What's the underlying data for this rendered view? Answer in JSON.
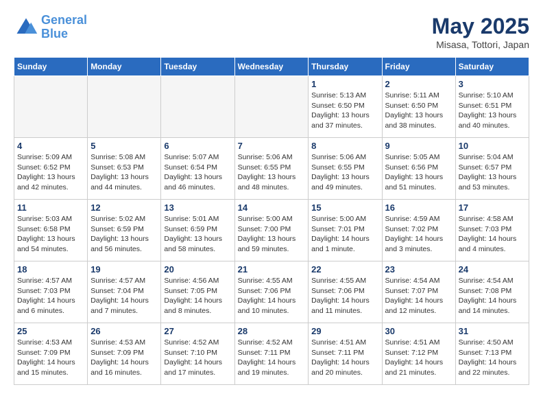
{
  "logo": {
    "line1": "General",
    "line2": "Blue"
  },
  "title": "May 2025",
  "subtitle": "Misasa, Tottori, Japan",
  "weekdays": [
    "Sunday",
    "Monday",
    "Tuesday",
    "Wednesday",
    "Thursday",
    "Friday",
    "Saturday"
  ],
  "weeks": [
    [
      {
        "day": "",
        "info": ""
      },
      {
        "day": "",
        "info": ""
      },
      {
        "day": "",
        "info": ""
      },
      {
        "day": "",
        "info": ""
      },
      {
        "day": "1",
        "info": "Sunrise: 5:13 AM\nSunset: 6:50 PM\nDaylight: 13 hours\nand 37 minutes."
      },
      {
        "day": "2",
        "info": "Sunrise: 5:11 AM\nSunset: 6:50 PM\nDaylight: 13 hours\nand 38 minutes."
      },
      {
        "day": "3",
        "info": "Sunrise: 5:10 AM\nSunset: 6:51 PM\nDaylight: 13 hours\nand 40 minutes."
      }
    ],
    [
      {
        "day": "4",
        "info": "Sunrise: 5:09 AM\nSunset: 6:52 PM\nDaylight: 13 hours\nand 42 minutes."
      },
      {
        "day": "5",
        "info": "Sunrise: 5:08 AM\nSunset: 6:53 PM\nDaylight: 13 hours\nand 44 minutes."
      },
      {
        "day": "6",
        "info": "Sunrise: 5:07 AM\nSunset: 6:54 PM\nDaylight: 13 hours\nand 46 minutes."
      },
      {
        "day": "7",
        "info": "Sunrise: 5:06 AM\nSunset: 6:55 PM\nDaylight: 13 hours\nand 48 minutes."
      },
      {
        "day": "8",
        "info": "Sunrise: 5:06 AM\nSunset: 6:55 PM\nDaylight: 13 hours\nand 49 minutes."
      },
      {
        "day": "9",
        "info": "Sunrise: 5:05 AM\nSunset: 6:56 PM\nDaylight: 13 hours\nand 51 minutes."
      },
      {
        "day": "10",
        "info": "Sunrise: 5:04 AM\nSunset: 6:57 PM\nDaylight: 13 hours\nand 53 minutes."
      }
    ],
    [
      {
        "day": "11",
        "info": "Sunrise: 5:03 AM\nSunset: 6:58 PM\nDaylight: 13 hours\nand 54 minutes."
      },
      {
        "day": "12",
        "info": "Sunrise: 5:02 AM\nSunset: 6:59 PM\nDaylight: 13 hours\nand 56 minutes."
      },
      {
        "day": "13",
        "info": "Sunrise: 5:01 AM\nSunset: 6:59 PM\nDaylight: 13 hours\nand 58 minutes."
      },
      {
        "day": "14",
        "info": "Sunrise: 5:00 AM\nSunset: 7:00 PM\nDaylight: 13 hours\nand 59 minutes."
      },
      {
        "day": "15",
        "info": "Sunrise: 5:00 AM\nSunset: 7:01 PM\nDaylight: 14 hours\nand 1 minute."
      },
      {
        "day": "16",
        "info": "Sunrise: 4:59 AM\nSunset: 7:02 PM\nDaylight: 14 hours\nand 3 minutes."
      },
      {
        "day": "17",
        "info": "Sunrise: 4:58 AM\nSunset: 7:03 PM\nDaylight: 14 hours\nand 4 minutes."
      }
    ],
    [
      {
        "day": "18",
        "info": "Sunrise: 4:57 AM\nSunset: 7:03 PM\nDaylight: 14 hours\nand 6 minutes."
      },
      {
        "day": "19",
        "info": "Sunrise: 4:57 AM\nSunset: 7:04 PM\nDaylight: 14 hours\nand 7 minutes."
      },
      {
        "day": "20",
        "info": "Sunrise: 4:56 AM\nSunset: 7:05 PM\nDaylight: 14 hours\nand 8 minutes."
      },
      {
        "day": "21",
        "info": "Sunrise: 4:55 AM\nSunset: 7:06 PM\nDaylight: 14 hours\nand 10 minutes."
      },
      {
        "day": "22",
        "info": "Sunrise: 4:55 AM\nSunset: 7:06 PM\nDaylight: 14 hours\nand 11 minutes."
      },
      {
        "day": "23",
        "info": "Sunrise: 4:54 AM\nSunset: 7:07 PM\nDaylight: 14 hours\nand 12 minutes."
      },
      {
        "day": "24",
        "info": "Sunrise: 4:54 AM\nSunset: 7:08 PM\nDaylight: 14 hours\nand 14 minutes."
      }
    ],
    [
      {
        "day": "25",
        "info": "Sunrise: 4:53 AM\nSunset: 7:09 PM\nDaylight: 14 hours\nand 15 minutes."
      },
      {
        "day": "26",
        "info": "Sunrise: 4:53 AM\nSunset: 7:09 PM\nDaylight: 14 hours\nand 16 minutes."
      },
      {
        "day": "27",
        "info": "Sunrise: 4:52 AM\nSunset: 7:10 PM\nDaylight: 14 hours\nand 17 minutes."
      },
      {
        "day": "28",
        "info": "Sunrise: 4:52 AM\nSunset: 7:11 PM\nDaylight: 14 hours\nand 19 minutes."
      },
      {
        "day": "29",
        "info": "Sunrise: 4:51 AM\nSunset: 7:11 PM\nDaylight: 14 hours\nand 20 minutes."
      },
      {
        "day": "30",
        "info": "Sunrise: 4:51 AM\nSunset: 7:12 PM\nDaylight: 14 hours\nand 21 minutes."
      },
      {
        "day": "31",
        "info": "Sunrise: 4:50 AM\nSunset: 7:13 PM\nDaylight: 14 hours\nand 22 minutes."
      }
    ]
  ]
}
